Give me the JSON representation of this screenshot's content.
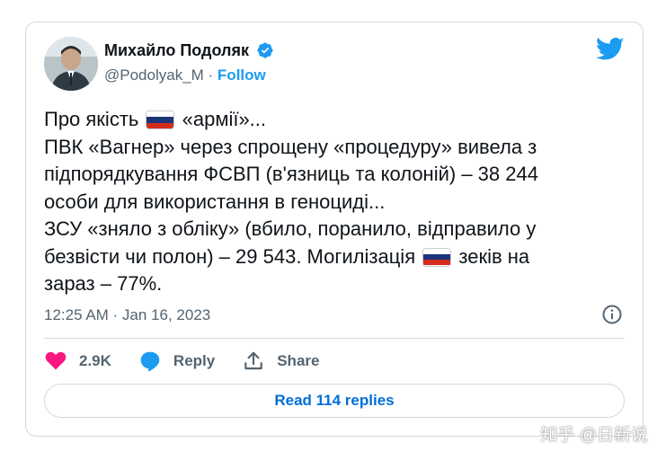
{
  "tweet": {
    "author_name": "Михайло Подоляк",
    "handle": "@Podolyak_M",
    "separator": " · ",
    "follow_label": "Follow",
    "text": {
      "line1_before_flag": "Про якість",
      "line1_after_flag": "«армії»...",
      "line2": "ПВК «Вагнер» через спрощену «процедуру» вивела з",
      "line3": "підпорядкування ФСВП (в'язниць та колоній) – 38 244",
      "line4": "особи для використання в геноциді...",
      "line5": "ЗСУ «зняло з обліку» (вбило, поранило, відправило у",
      "line6_before_flag": "безвісти чи полон) – 29 543. Могилізація",
      "line6_after_flag": "зеків на",
      "line7": "зараз – 77%."
    },
    "timestamp": "12:25 AM · Jan 16, 2023",
    "actions": {
      "likes_count": "2.9K",
      "reply_label": "Reply",
      "share_label": "Share"
    },
    "read_replies_label": "Read 114 replies"
  },
  "watermark": "知乎 @日新说",
  "colors": {
    "accent": "#1d9bf0",
    "like": "#f91880",
    "muted": "#536471",
    "text": "#0f1419",
    "border": "#cfd9de",
    "flag_white": "#ffffff",
    "flag_blue": "#1c3578",
    "flag_red": "#d52b1e"
  },
  "icons": [
    "verified-badge-icon",
    "twitter-bird-icon",
    "russia-flag-icon",
    "info-icon",
    "heart-icon",
    "reply-bubble-icon",
    "share-icon"
  ]
}
